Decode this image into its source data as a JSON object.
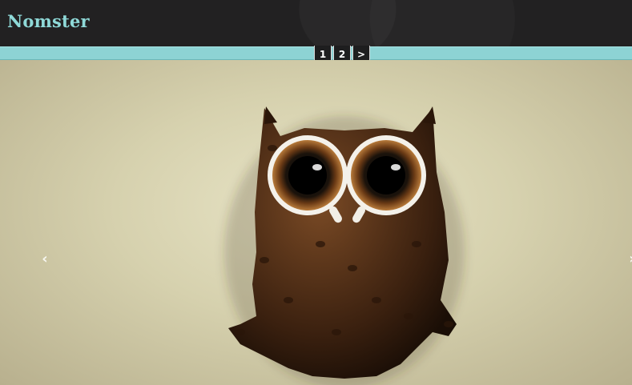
{
  "site": {
    "logo_text": "Nomster"
  },
  "pager": {
    "buttons": [
      "1",
      "2",
      ">"
    ]
  },
  "carousel": {
    "prev_icon": "chevron-left-icon",
    "next_icon": "chevron-right-icon"
  },
  "colors": {
    "accent": "#8dd3d4",
    "header_bg": "#222122",
    "logo": "#8fd9d8"
  }
}
